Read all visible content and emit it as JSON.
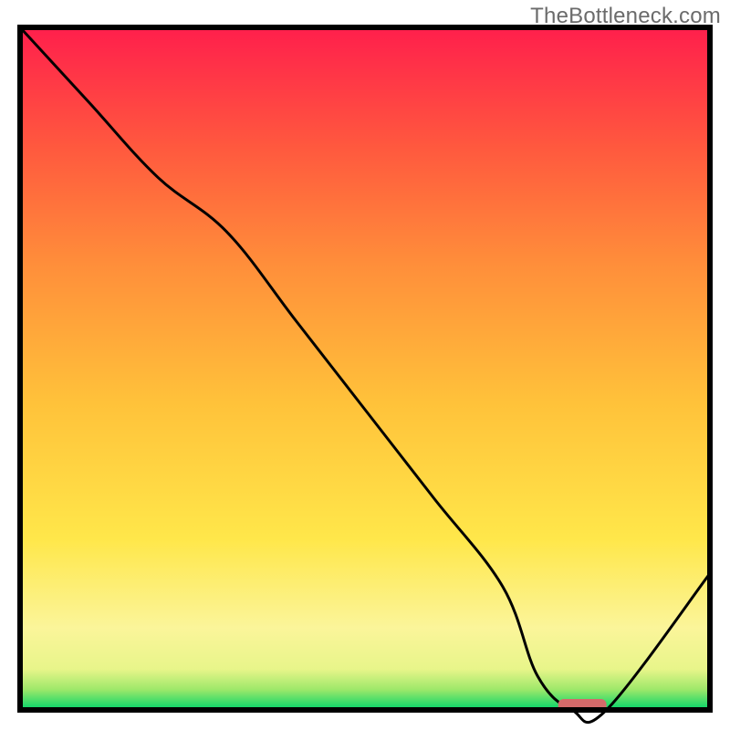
{
  "watermark": "TheBottleneck.com",
  "chart_data": {
    "type": "line",
    "title": "",
    "xlabel": "",
    "ylabel": "",
    "xlim": [
      0,
      100
    ],
    "ylim": [
      0,
      100
    ],
    "grid": false,
    "series": [
      {
        "name": "bottleneck-curve",
        "x": [
          0,
          10,
          20,
          30,
          40,
          50,
          60,
          70,
          75,
          80,
          85,
          100
        ],
        "values": [
          100,
          89,
          78,
          70,
          57,
          44,
          31,
          18,
          5,
          0,
          0,
          20
        ]
      }
    ],
    "marker": {
      "name": "optimal-range",
      "x_start": 78,
      "x_end": 85,
      "y": 0,
      "color": "#d46a6a"
    },
    "gradient_stops": [
      {
        "offset": 0.0,
        "color": "#00d46a"
      },
      {
        "offset": 0.03,
        "color": "#9ee86a"
      },
      {
        "offset": 0.06,
        "color": "#e8f58a"
      },
      {
        "offset": 0.12,
        "color": "#fbf59a"
      },
      {
        "offset": 0.25,
        "color": "#ffe74a"
      },
      {
        "offset": 0.45,
        "color": "#ffc23a"
      },
      {
        "offset": 0.65,
        "color": "#ff8f3a"
      },
      {
        "offset": 0.82,
        "color": "#ff5a3e"
      },
      {
        "offset": 1.0,
        "color": "#ff1f4c"
      }
    ]
  }
}
